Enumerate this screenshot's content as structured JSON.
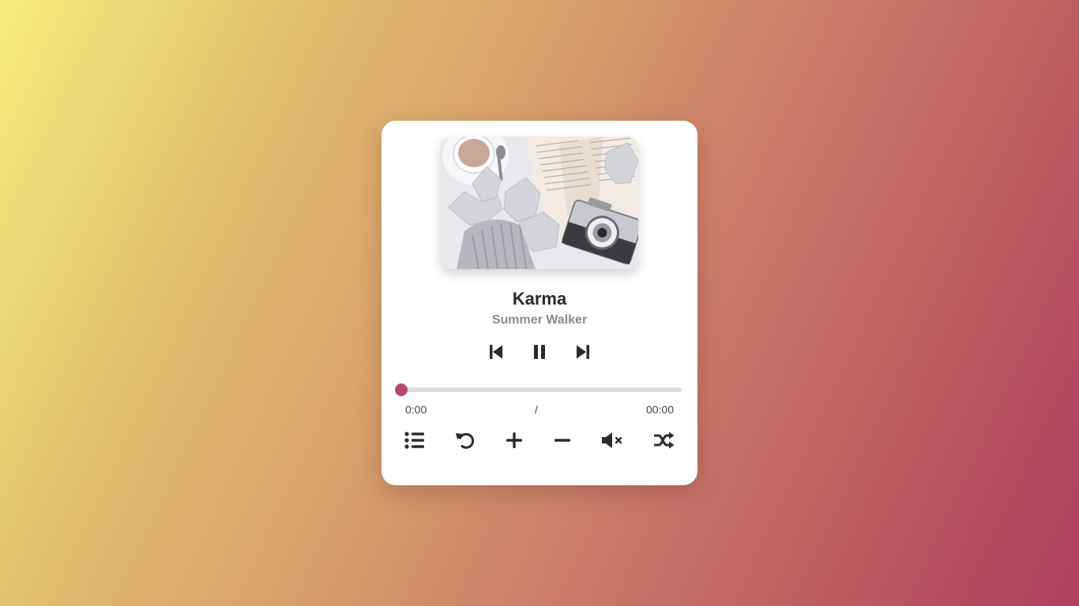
{
  "track": {
    "title": "Karma",
    "artist": "Summer Walker"
  },
  "playback": {
    "current_time": "0:00",
    "separator": "/",
    "duration": "00:00",
    "progress_fraction": 0.0,
    "state": "playing"
  },
  "controls": {
    "main": [
      "previous-icon",
      "pause-icon",
      "next-icon"
    ],
    "tools": [
      "playlist-icon",
      "repeat-icon",
      "volume-up-icon",
      "volume-down-icon",
      "mute-icon",
      "shuffle-icon"
    ]
  },
  "colors": {
    "accent": "#b54a68",
    "track_bg": "#dfdddd",
    "card_bg": "#ffffff",
    "title_color": "#2b2b2b",
    "artist_color": "#8a8a8a",
    "background_start": "#f5ee7a",
    "background_end": "#ad3e60"
  }
}
